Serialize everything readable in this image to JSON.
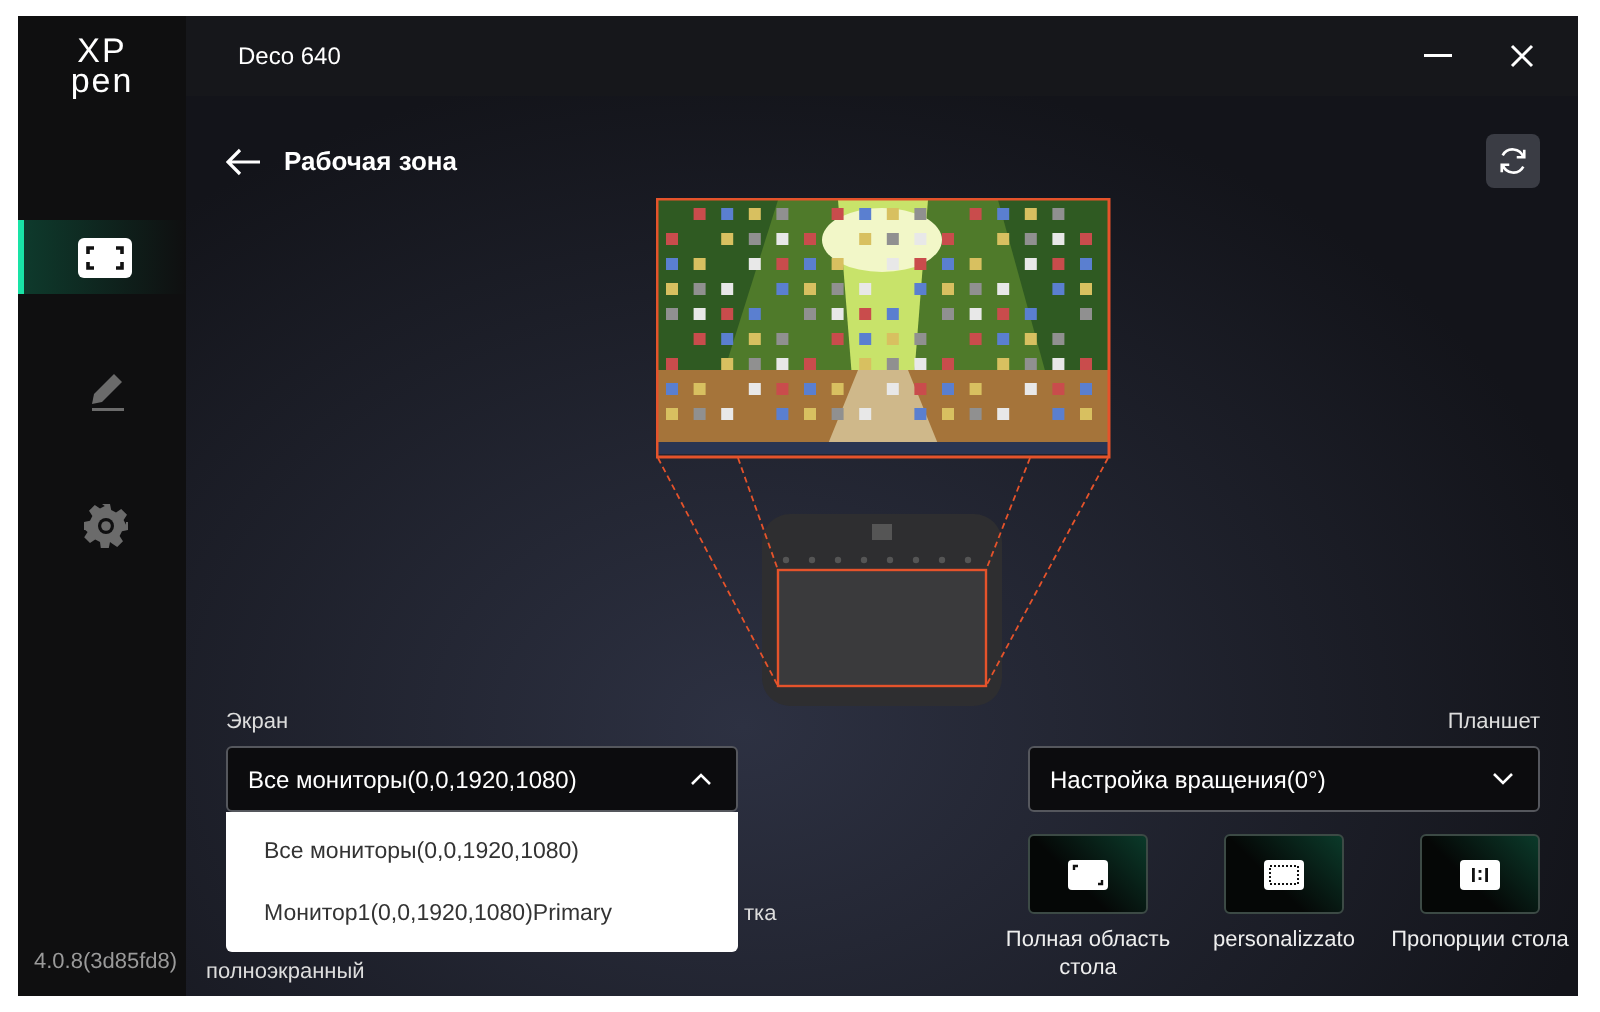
{
  "window": {
    "title": "Deco 640",
    "logo": [
      "XP",
      "pen"
    ]
  },
  "sidebar": {
    "items": [
      {
        "kind": "area",
        "selected": true
      },
      {
        "kind": "pen",
        "selected": false
      },
      {
        "kind": "settings",
        "selected": false
      }
    ],
    "version": "4.0.8(3d85fd8)"
  },
  "page": {
    "title": "Рабочая зона"
  },
  "screen": {
    "label": "Экран",
    "value": "Все мониторы(0,0,1920,1080)",
    "expanded": true,
    "options": [
      "Все мониторы(0,0,1920,1080)",
      "Монитор1(0,0,1920,1080)Primary"
    ],
    "mode_labels": [
      "тка",
      "полноэкранный"
    ]
  },
  "tablet": {
    "label": "Планшет",
    "value": "Настройка вращения(0°)",
    "expanded": false,
    "modes": [
      {
        "kind": "full",
        "label": "Полная область стола"
      },
      {
        "kind": "custom",
        "label": "personalizzato"
      },
      {
        "kind": "ratio",
        "label": "Пропорции стола"
      }
    ]
  }
}
